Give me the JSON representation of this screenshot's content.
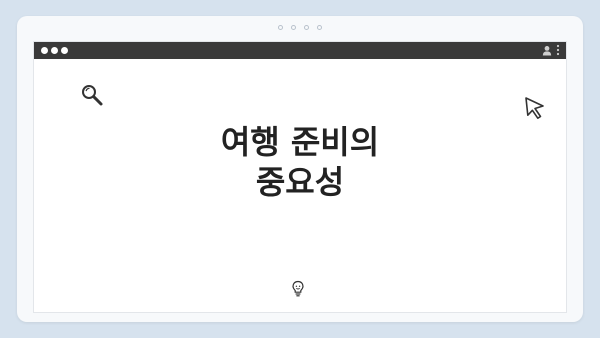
{
  "titlebar": {
    "controls": [
      "close",
      "minimize",
      "maximize"
    ],
    "right_icons": [
      "user-icon",
      "kebab-menu-icon"
    ]
  },
  "slide": {
    "title_lines": [
      "여행 준비의",
      "중요성"
    ]
  },
  "icons": {
    "top_left": "search-icon",
    "top_right": "cursor-icon",
    "bottom": "lightbulb-icon"
  },
  "colors": {
    "background": "#d6e2ee",
    "card": "#f7f9fb",
    "titlebar": "#3a3a3a",
    "title_text": "#222222"
  }
}
